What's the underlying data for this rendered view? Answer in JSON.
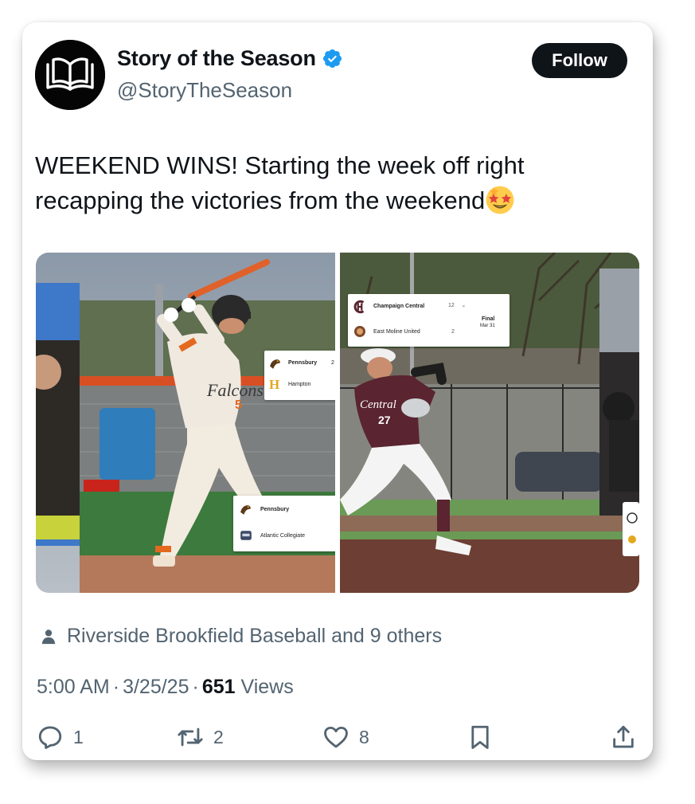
{
  "account": {
    "display_name": "Story of the Season",
    "handle": "@StoryTheSeason",
    "verified": true,
    "follow_label": "Follow"
  },
  "tweet": {
    "text": "WEEKEND WINS! Starting the week off right recapping the victories from the weekend",
    "emoji": "star-struck-emoji"
  },
  "media": {
    "photo_1": {
      "scorecard_top": {
        "team_1": "Pennsbury",
        "score_1": "2",
        "team_2": "Hampton"
      },
      "scorecard_bottom": {
        "team_1": "Pennsbury",
        "team_2": "Atlantic Collegiate"
      },
      "jersey_number": "5"
    },
    "photo_2": {
      "scorecard": {
        "team_1": "Champaign Central",
        "score_1": "12",
        "team_2": "East Moline United",
        "score_2": "2",
        "status": "Final",
        "date": "Mar 31"
      },
      "jersey_text": "Central",
      "jersey_number": "27"
    }
  },
  "social_context": "Riverside Brookfield Baseball and 9 others",
  "meta": {
    "time": "5:00 AM",
    "date": "3/25/25",
    "views_count": "651",
    "views_label": "Views"
  },
  "actions": {
    "reply_count": "1",
    "retweet_count": "2",
    "like_count": "8"
  },
  "colors": {
    "verified": "#1d9bf0",
    "secondary_text": "#536471",
    "primary_text": "#0f1419"
  }
}
